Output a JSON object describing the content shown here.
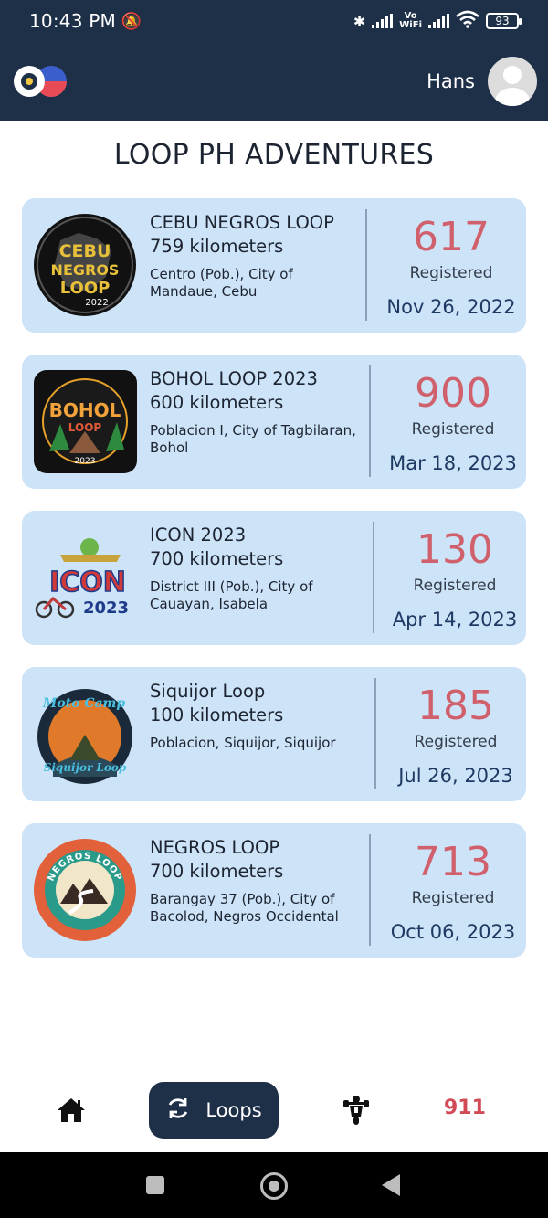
{
  "status_bar": {
    "time": "10:43 PM",
    "vowifi_top": "Vo",
    "vowifi_bottom": "WiFi",
    "battery": "93"
  },
  "app_bar": {
    "username": "Hans"
  },
  "page": {
    "title": "LOOP PH ADVENTURES"
  },
  "loops": [
    {
      "name": "CEBU NEGROS LOOP",
      "distance": "759 kilometers",
      "location": "Centro (Pob.), City of Mandaue, Cebu",
      "registered_count": "617",
      "registered_label": "Registered",
      "date": "Nov 26, 2022",
      "badge_line1": "CEBU",
      "badge_line2": "NEGROS",
      "badge_line3": "LOOP",
      "badge_year": "2022"
    },
    {
      "name": "BOHOL LOOP 2023",
      "distance": "600 kilometers",
      "location": "Poblacion I, City of Tagbilaran, Bohol",
      "registered_count": "900",
      "registered_label": "Registered",
      "date": "Mar 18, 2023",
      "badge_line1": "BOHOL",
      "badge_line2": "LOOP",
      "badge_year": "2023"
    },
    {
      "name": "ICON 2023",
      "distance": "700 kilometers",
      "location": "District III (Pob.), City of Cauayan, Isabela",
      "registered_count": "130",
      "registered_label": "Registered",
      "date": "Apr 14, 2023",
      "badge_line1": "ICON",
      "badge_year": "2023"
    },
    {
      "name": "Siquijor Loop",
      "distance": "100 kilometers",
      "location": "Poblacion, Siquijor, Siquijor",
      "registered_count": "185",
      "registered_label": "Registered",
      "date": "Jul 26, 2023",
      "badge_line1": "Moto Camp",
      "badge_line2": "Siquijor Loop"
    },
    {
      "name": "NEGROS LOOP",
      "distance": "700 kilometers",
      "location": "Barangay 37 (Pob.), City of Bacolod, Negros Occidental",
      "registered_count": "713",
      "registered_label": "Registered",
      "date": "Oct 06, 2023",
      "badge_line1": "NEGROS LOOP"
    }
  ],
  "bottom_nav": {
    "loops_label": "Loops",
    "emergency_label": "911"
  },
  "colors": {
    "header_bg": "#1e3048",
    "card_bg": "#cde3f8",
    "count_color": "#d0606b",
    "emergency_color": "#d24a55"
  }
}
